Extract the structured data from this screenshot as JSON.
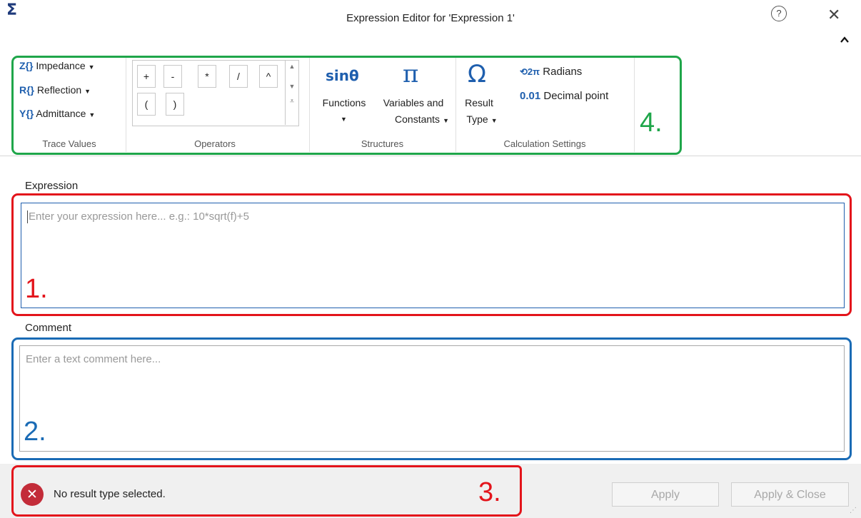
{
  "window": {
    "title": "Expression Editor for 'Expression 1'",
    "app_icon": "Σ",
    "help_icon": "?",
    "close_icon": "✕"
  },
  "ribbon": {
    "trace_values": {
      "label": "Trace Values",
      "items": [
        {
          "prefix": "Z{}",
          "label": "Impedance"
        },
        {
          "prefix": "R{}",
          "label": "Reflection"
        },
        {
          "prefix": "Y{}",
          "label": "Admittance"
        }
      ]
    },
    "operators": {
      "label": "Operators",
      "row1": [
        "+",
        "-",
        "*",
        "/",
        "^"
      ],
      "row2": [
        "(",
        ")"
      ]
    },
    "structures": {
      "label": "Structures",
      "functions": {
        "icon_text": "sinθ",
        "label": "Functions"
      },
      "variables": {
        "icon_text": "π",
        "label_line1": "Variables and",
        "label_line2": "Constants"
      }
    },
    "calculation_settings": {
      "label": "Calculation Settings",
      "result_type": {
        "icon_text": "Ω",
        "label_line1": "Result",
        "label_line2": "Type"
      },
      "radians": {
        "icon_text": "2π",
        "label": "Radians"
      },
      "decimal": {
        "icon_text": "0.01",
        "label": "Decimal point"
      }
    }
  },
  "expression": {
    "label": "Expression",
    "placeholder": "Enter your expression here... e.g.: 10*sqrt(f)+5"
  },
  "comment": {
    "label": "Comment",
    "placeholder": "Enter a text comment here..."
  },
  "status": {
    "error_icon": "✕",
    "message": "No result type selected."
  },
  "buttons": {
    "apply": "Apply",
    "apply_close": "Apply & Close"
  },
  "annotations": {
    "box1": "1.",
    "box2": "2.",
    "box3": "3.",
    "box4": "4.",
    "colors": {
      "box1": "#e3141b",
      "box2": "#1a6bb5",
      "box3": "#e3141b",
      "box4": "#1fa64a"
    }
  }
}
